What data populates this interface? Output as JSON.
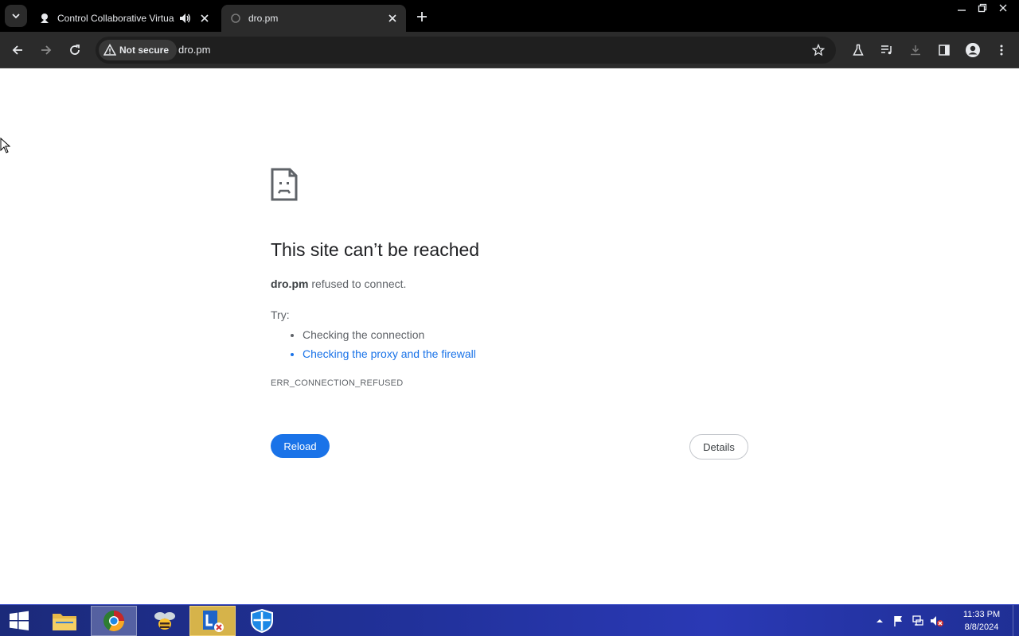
{
  "browser": {
    "tabs": [
      {
        "title": "Control Collaborative Virtua",
        "favicon": "app-favicon",
        "audio": true
      },
      {
        "title": "dro.pm",
        "favicon": "globe-favicon",
        "active": true
      }
    ],
    "omnibox": {
      "security_label": "Not secure",
      "url": "dro.pm"
    }
  },
  "error_page": {
    "title": "This site can’t be reached",
    "host": "dro.pm",
    "description": " refused to connect.",
    "try_label": "Try:",
    "suggestions": [
      {
        "text": "Checking the connection",
        "link": false
      },
      {
        "text": "Checking the proxy and the firewall",
        "link": true
      }
    ],
    "error_code": "ERR_CONNECTION_REFUSED",
    "reload_label": "Reload",
    "details_label": "Details"
  },
  "taskbar": {
    "apps": [
      "file-explorer",
      "chrome",
      "bee-app",
      "lync",
      "security-shield"
    ],
    "clock": {
      "time": "11:33 PM",
      "date": "8/8/2024"
    }
  },
  "colors": {
    "tab_strip": "#000000",
    "toolbar": "#2b2b2b",
    "link_blue": "#1a73e8",
    "reload_bg": "#1a73e8",
    "title_text": "#202124"
  }
}
